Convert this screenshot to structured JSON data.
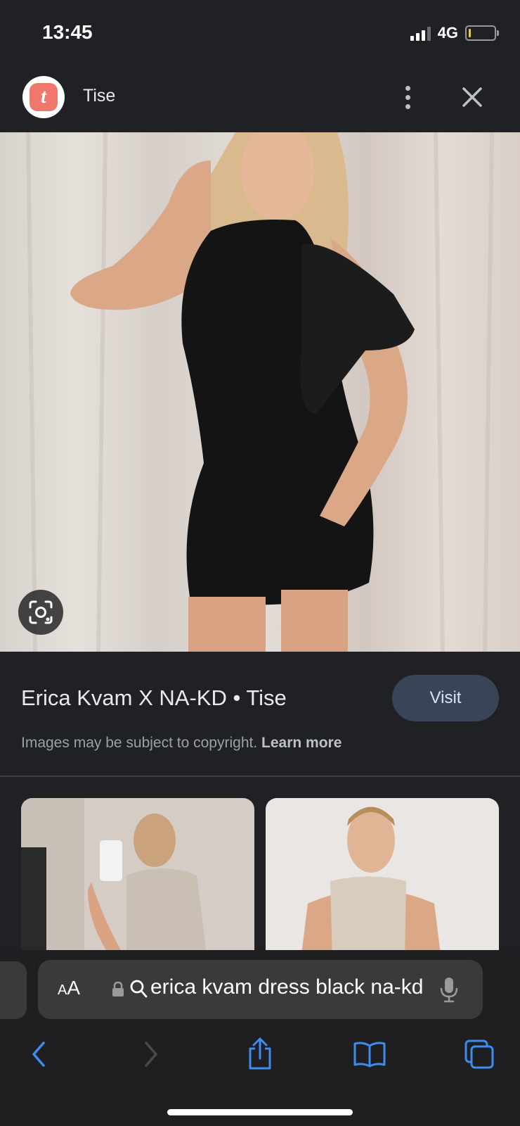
{
  "status_bar": {
    "time": "13:45",
    "network": "4G",
    "signal_bars_active": 3,
    "signal_bars_total": 4,
    "battery_level": 0.08
  },
  "header": {
    "favicon_letter": "t",
    "site_name": "Tise",
    "accent_color": "#f0776c"
  },
  "result": {
    "title": "Erica Kvam X NA-KD • Tise",
    "visit_label": "Visit",
    "copyright_text": "Images may be subject to copyright.",
    "learn_more_label": "Learn more"
  },
  "browser": {
    "aa_label_small": "A",
    "aa_label_large": "A",
    "url_text": "erica kvam dress black na-kd"
  },
  "colors": {
    "background": "#202124",
    "visit_button": "#394457",
    "ios_blue": "#3b8df0"
  }
}
